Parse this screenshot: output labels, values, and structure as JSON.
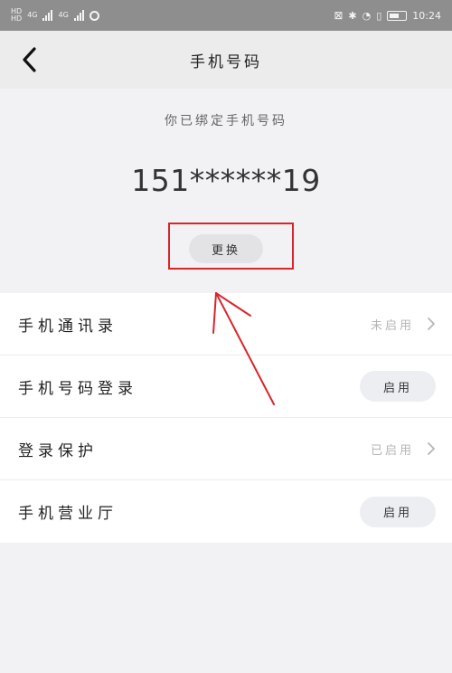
{
  "status_bar": {
    "time": "10:24",
    "left_small_top": "HD",
    "left_small_bottom": "HD",
    "sig1_label": "4G",
    "sig2_label": "4G"
  },
  "header": {
    "title": "手机号码"
  },
  "bound": {
    "label": "你已绑定手机号码",
    "phone": "151******19",
    "change_button": "更换"
  },
  "settings": [
    {
      "label": "手机通讯录",
      "status": "未启用",
      "control": "chevron"
    },
    {
      "label": "手机号码登录",
      "button": "启用",
      "control": "button"
    },
    {
      "label": "登录保护",
      "status": "已启用",
      "control": "chevron"
    },
    {
      "label": "手机营业厅",
      "button": "启用",
      "control": "button"
    }
  ],
  "colors": {
    "annotation": "#d8262c",
    "background": "#f2f2f4"
  }
}
